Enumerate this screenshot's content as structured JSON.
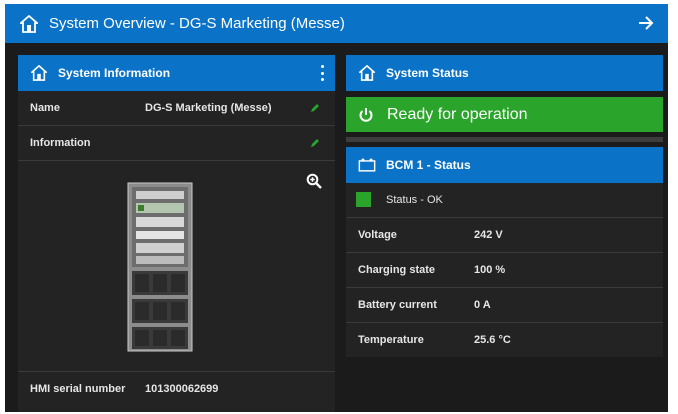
{
  "app": {
    "title": "System Overview  - DG-S Marketing (Messe)"
  },
  "system_info": {
    "header": "System Information",
    "rows": [
      {
        "label": "Name",
        "value": "DG-S Marketing (Messe)"
      },
      {
        "label": "Information",
        "value": ""
      }
    ],
    "serial_label": "HMI serial number",
    "serial_value": "101300062699"
  },
  "system_status": {
    "header": "System Status",
    "state": "Ready for operation",
    "state_color": "#2aa42a"
  },
  "bcm": {
    "header": "BCM 1 - Status",
    "status_text": "Status - OK",
    "status_color": "#2aa42a",
    "rows": [
      {
        "label": "Voltage",
        "value": "242 V"
      },
      {
        "label": "Charging state",
        "value": "100 %"
      },
      {
        "label": "Battery current",
        "value": "0 A"
      },
      {
        "label": "Temperature",
        "value": "25.6 °C"
      }
    ]
  },
  "colors": {
    "accent": "#0b73c7",
    "background": "#1b1b1b",
    "panel": "#232323",
    "ok": "#2aa42a"
  },
  "icons": {
    "header": "home-icon",
    "next": "arrow-right-icon",
    "menu": "kebab-menu-icon",
    "edit": "pencil-icon",
    "zoom": "zoom-in-icon",
    "power": "power-icon",
    "battery": "battery-icon"
  }
}
